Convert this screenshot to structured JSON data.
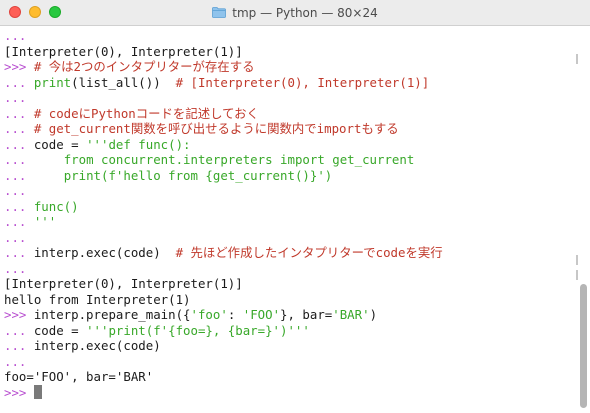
{
  "window": {
    "title": "tmp — Python — 80×24"
  },
  "icons": {
    "title_icon": "folder-icon"
  },
  "colors": {
    "prompt": "#b84fd0",
    "comment": "#c0392b",
    "green": "#38a829",
    "text": "#1b1b1b"
  },
  "terminal": {
    "lines": [
      [
        {
          "t": "...",
          "c": "prompt"
        }
      ],
      [
        {
          "t": "[Interpreter(0), Interpreter(1)]",
          "c": "code"
        }
      ],
      [
        {
          "t": ">>> ",
          "c": "prompt"
        },
        {
          "t": "# 今は2つのインタプリターが存在する",
          "c": "comment"
        }
      ],
      [
        {
          "t": "... ",
          "c": "prompt"
        },
        {
          "t": "print",
          "c": "green"
        },
        {
          "t": "(list_all())  ",
          "c": "code"
        },
        {
          "t": "# [Interpreter(0), Interpreter(1)]",
          "c": "comment"
        }
      ],
      [
        {
          "t": "...",
          "c": "prompt"
        }
      ],
      [
        {
          "t": "... ",
          "c": "prompt"
        },
        {
          "t": "# codeにPythonコードを記述しておく",
          "c": "comment"
        }
      ],
      [
        {
          "t": "... ",
          "c": "prompt"
        },
        {
          "t": "# get_current関数を呼び出せるように関数内でimportもする",
          "c": "comment"
        }
      ],
      [
        {
          "t": "... ",
          "c": "prompt"
        },
        {
          "t": "code = ",
          "c": "code"
        },
        {
          "t": "'''def func():",
          "c": "green"
        }
      ],
      [
        {
          "t": "...     ",
          "c": "prompt"
        },
        {
          "t": "from concurrent.interpreters import get_current",
          "c": "green"
        }
      ],
      [
        {
          "t": "...     ",
          "c": "prompt"
        },
        {
          "t": "print(f'hello from {get_current()}')",
          "c": "green"
        }
      ],
      [
        {
          "t": "...",
          "c": "prompt"
        }
      ],
      [
        {
          "t": "... ",
          "c": "prompt"
        },
        {
          "t": "func()",
          "c": "green"
        }
      ],
      [
        {
          "t": "... ",
          "c": "prompt"
        },
        {
          "t": "'''",
          "c": "green"
        }
      ],
      [
        {
          "t": "...",
          "c": "prompt"
        }
      ],
      [
        {
          "t": "... ",
          "c": "prompt"
        },
        {
          "t": "interp.exec(code)  ",
          "c": "code"
        },
        {
          "t": "# 先ほど作成したインタプリターでcodeを実行",
          "c": "comment"
        }
      ],
      [
        {
          "t": "...",
          "c": "prompt"
        }
      ],
      [
        {
          "t": "[Interpreter(0), Interpreter(1)]",
          "c": "code"
        }
      ],
      [
        {
          "t": "hello from Interpreter(1)",
          "c": "code"
        }
      ],
      [
        {
          "t": ">>> ",
          "c": "prompt"
        },
        {
          "t": "interp.prepare_main({",
          "c": "code"
        },
        {
          "t": "'foo'",
          "c": "green"
        },
        {
          "t": ": ",
          "c": "code"
        },
        {
          "t": "'FOO'",
          "c": "green"
        },
        {
          "t": "}, bar=",
          "c": "code"
        },
        {
          "t": "'BAR'",
          "c": "green"
        },
        {
          "t": ")",
          "c": "code"
        }
      ],
      [
        {
          "t": "... ",
          "c": "prompt"
        },
        {
          "t": "code = ",
          "c": "code"
        },
        {
          "t": "'''print(f'{foo=}, {bar=}')'''",
          "c": "green"
        }
      ],
      [
        {
          "t": "... ",
          "c": "prompt"
        },
        {
          "t": "interp.exec(code)",
          "c": "code"
        }
      ],
      [
        {
          "t": "...",
          "c": "prompt"
        }
      ],
      [
        {
          "t": "foo='FOO', bar='BAR'",
          "c": "code"
        }
      ],
      [
        {
          "t": ">>> ",
          "c": "prompt"
        }
      ]
    ]
  }
}
